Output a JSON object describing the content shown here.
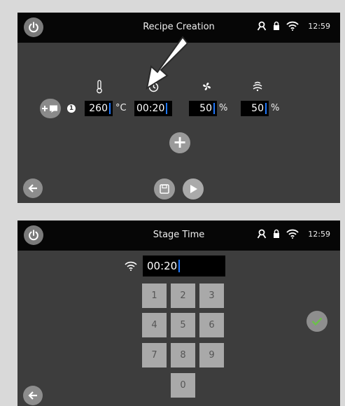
{
  "screen1": {
    "title": "Recipe Creation",
    "clock": "12:59",
    "stage_number": "1",
    "temperature": {
      "value": "260",
      "unit": "°C"
    },
    "time": {
      "value": "00:20"
    },
    "fan": {
      "value": "50",
      "unit": "%"
    },
    "humidity": {
      "value": "50",
      "unit": "%"
    },
    "add_stage_label": "+"
  },
  "screen2": {
    "title": "Stage Time",
    "clock": "12:59",
    "time_value": "00:20",
    "keys": [
      "1",
      "2",
      "3",
      "4",
      "5",
      "6",
      "7",
      "8",
      "9",
      "0"
    ]
  },
  "colors": {
    "panel": "#3d3d3d",
    "bar": "#060606",
    "cursor": "#1e78ff",
    "confirm": "#6cc04a"
  }
}
